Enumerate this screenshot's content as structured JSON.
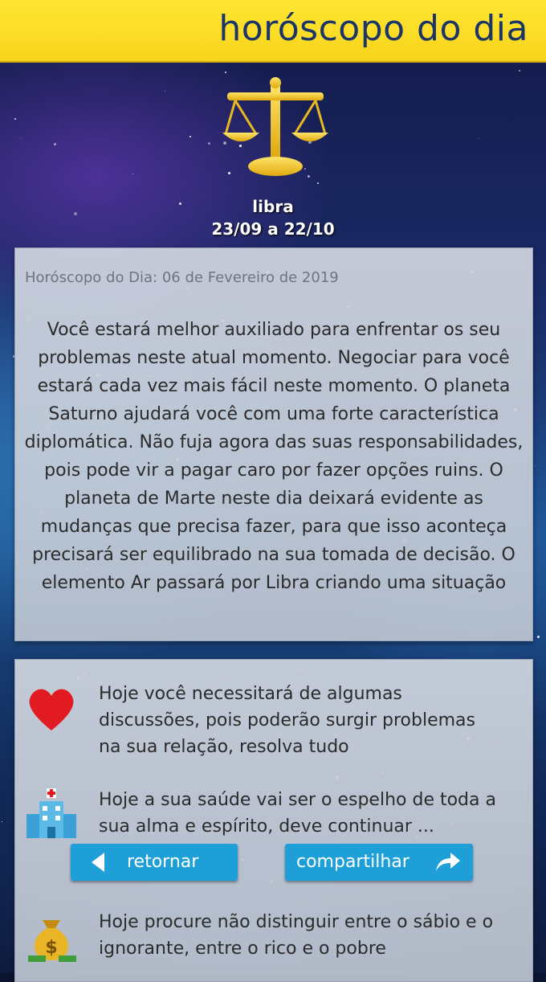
{
  "header": {
    "title": "horóscopo do dia"
  },
  "sign": {
    "name": "libra",
    "dates": "23/09 a 22/10",
    "icon": "libra-scales-icon"
  },
  "daily": {
    "date_line": "Horóscopo do Dia: 06 de Fevereiro de 2019",
    "text": "Você estará melhor auxiliado para enfrentar os seu problemas neste atual momento. Negociar para você estará cada vez mais fácil neste momento. O planeta Saturno ajudará você com uma forte característica diplomática. Não fuja agora das suas responsabilidades, pois pode vir a pagar caro por fazer opções ruins. O planeta de Marte neste dia deixará evidente as mudanças que precisa fazer, para que isso aconteça precisará ser equilibrado na sua tomada de decisão. O elemento Ar passará por Libra criando uma situação"
  },
  "categories": [
    {
      "icon": "heart-icon",
      "text": "Hoje você necessitará de algumas discussões, pois poderão surgir problemas na sua relação, resolva tudo"
    },
    {
      "icon": "hospital-icon",
      "text": "Hoje a sua saúde vai ser o espelho de toda a sua alma e espírito, deve continuar ... melhor."
    },
    {
      "icon": "money-bag-icon",
      "text": "Hoje procure não distinguir entre o sábio e o ignorante, entre o rico e o pobre"
    }
  ],
  "buttons": {
    "back_label": "retornar",
    "share_label": "compartilhar"
  },
  "colors": {
    "header": "#f8d31b",
    "title": "#1a3566",
    "button": "#1f9fd8"
  }
}
